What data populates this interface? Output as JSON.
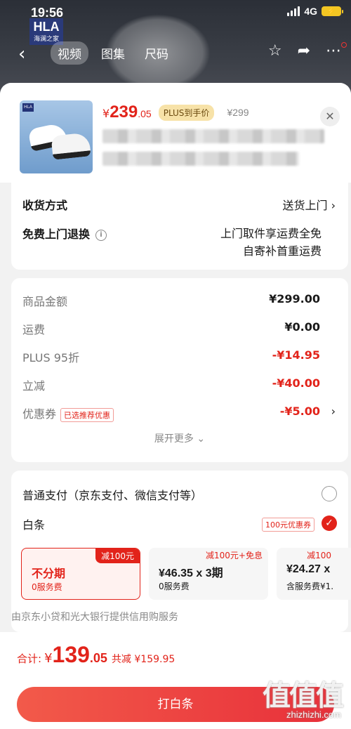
{
  "status_bar": {
    "time": "19:56",
    "network": "4G"
  },
  "header": {
    "brand_logo": "HLA",
    "brand_sub": "海澜之家",
    "tabs": [
      {
        "label": "视频",
        "active": true
      },
      {
        "label": "图集",
        "active": false
      },
      {
        "label": "尺码",
        "active": false
      }
    ],
    "icons": [
      "back-icon",
      "star-icon",
      "share-icon",
      "more-icon"
    ]
  },
  "product": {
    "price_symbol": "¥",
    "price_int": "239",
    "price_dec": ".05",
    "plus_tag": "PLUS到手价",
    "original_price": "¥299",
    "thumb_logo": "HLA"
  },
  "shipping": {
    "method_label": "收货方式",
    "method_value": "送货上门",
    "return_label": "免费上门退换",
    "return_line1": "上门取件享运费全免",
    "return_line2": "自寄补首重运费"
  },
  "price_detail": {
    "rows": [
      {
        "label": "商品金额",
        "value": "¥299.00",
        "negative": false
      },
      {
        "label": "运费",
        "value": "¥0.00",
        "negative": false
      },
      {
        "label": "PLUS 95折",
        "value": "-¥14.95",
        "negative": true
      },
      {
        "label": "立减",
        "value": "-¥40.00",
        "negative": true
      },
      {
        "label": "优惠券",
        "value": "-¥5.00",
        "negative": true
      }
    ],
    "coupon_tag": "已选推荐优惠",
    "expand_label": "展开更多"
  },
  "payment": {
    "normal_label": "普通支付（京东支付、微信支付等）",
    "baitiao_label": "白条",
    "baitiao_tag": "100元优惠券",
    "plans": [
      {
        "badge": "减100元",
        "main": "不分期",
        "sub": "0服务费",
        "selected": true
      },
      {
        "badge": "减100元+免息",
        "main": "¥46.35 x 3期",
        "sub": "0服务费",
        "selected": false
      },
      {
        "badge": "减100",
        "main": "¥24.27 x",
        "sub": "含服务费¥1.",
        "selected": false
      }
    ],
    "provider_note": "由京东小贷和光大银行提供信用购服务"
  },
  "footer": {
    "total_label": "合计:",
    "total_symbol": "¥",
    "total_int": "139",
    "total_dec": ".05",
    "total_saved": "共减 ¥159.95",
    "pay_button": "打白条"
  },
  "watermark": {
    "logo": "值值值",
    "url": "zhizhizhi.com"
  },
  "colors": {
    "accent_red": "#e2231a",
    "plus_gold": "#f7e2a8",
    "header_dark": "#2b2f37"
  }
}
